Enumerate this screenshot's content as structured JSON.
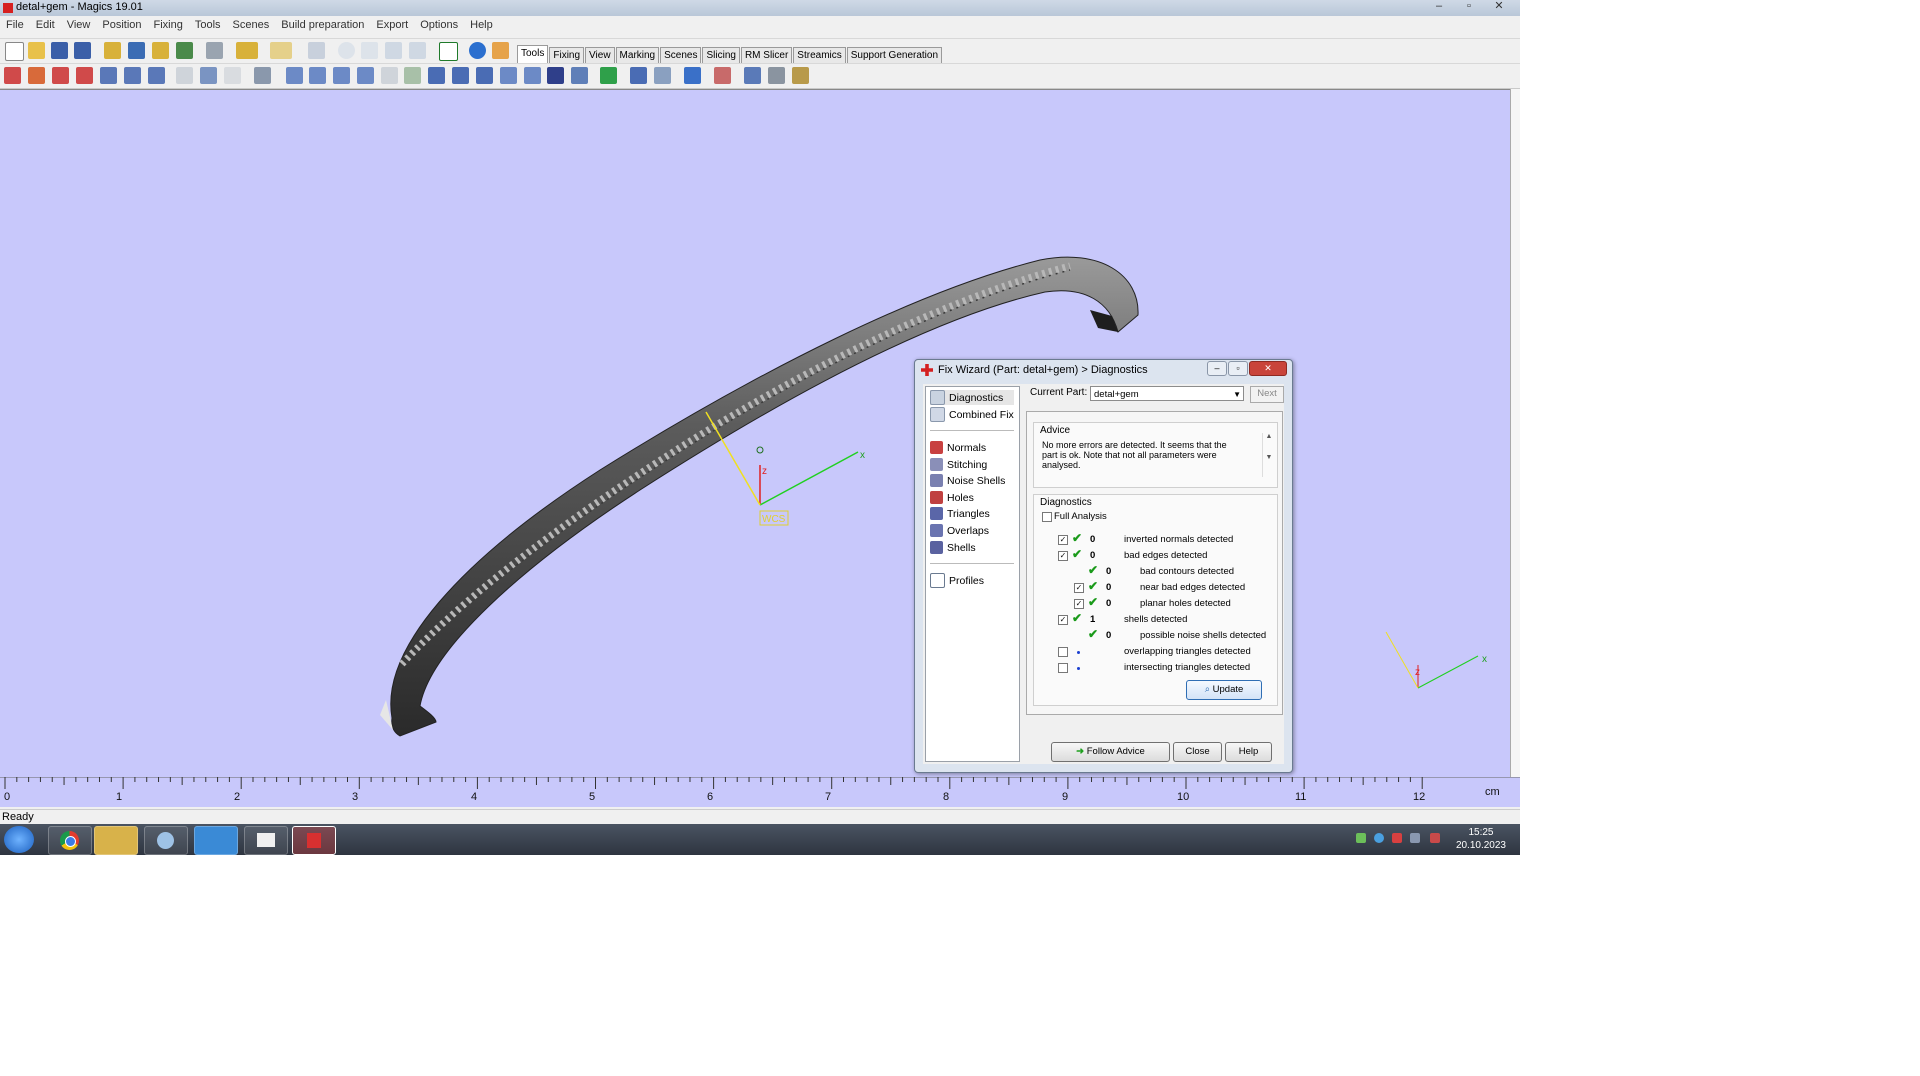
{
  "window": {
    "title": "detal+gem - Magics 19.01",
    "minimize": "–",
    "maximize": "▫",
    "close": "✕"
  },
  "menu": [
    "File",
    "Edit",
    "View",
    "Position",
    "Fixing",
    "Tools",
    "Scenes",
    "Build preparation",
    "Export",
    "Options",
    "Help"
  ],
  "tabs": [
    "Tools",
    "Fixing",
    "View",
    "Marking",
    "Scenes",
    "Slicing",
    "RM Slicer",
    "Streamics",
    "Support Generation"
  ],
  "active_tab": "Tools",
  "viewport": {
    "background": "#c8c8fb",
    "axis_labels": {
      "x": "x",
      "z": "z",
      "wcs": "WCS"
    },
    "ruler_labels": [
      "0",
      "1",
      "2",
      "3",
      "4",
      "5",
      "6",
      "7",
      "8",
      "9",
      "10",
      "11",
      "12"
    ],
    "ruler_unit": "cm"
  },
  "status": "Ready",
  "dialog": {
    "title": "Fix Wizard (Part: detal+gem) > Diagnostics",
    "title_buttons": {
      "minimize": "–",
      "maximize": "▫",
      "close": "✕"
    },
    "nav_top": [
      "Diagnostics",
      "Combined Fix"
    ],
    "nav_mid": [
      "Normals",
      "Stitching",
      "Noise Shells",
      "Holes",
      "Triangles",
      "Overlaps",
      "Shells"
    ],
    "nav_bottom": [
      "Profiles"
    ],
    "current_part_label": "Current Part:",
    "current_part_value": "detal+gem",
    "next_label": "Next",
    "advice_label": "Advice",
    "advice_text": "No more errors are detected. It seems that the part is ok. Note that not all parameters were analysed.",
    "diagnostics_label": "Diagnostics",
    "full_analysis_label": "Full Analysis",
    "rows": [
      {
        "checkbox": true,
        "status": "ok",
        "count": "0",
        "label": "inverted normals detected",
        "level": 0
      },
      {
        "checkbox": true,
        "status": "ok",
        "count": "0",
        "label": "bad edges detected",
        "level": 0
      },
      {
        "checkbox": null,
        "status": "ok",
        "count": "0",
        "label": "bad contours detected",
        "level": 1
      },
      {
        "checkbox": true,
        "status": "ok",
        "count": "0",
        "label": "near bad edges detected",
        "level": 1
      },
      {
        "checkbox": true,
        "status": "ok",
        "count": "0",
        "label": "planar holes detected",
        "level": 1
      },
      {
        "checkbox": true,
        "status": "ok",
        "count": "1",
        "label": "shells detected",
        "level": 0
      },
      {
        "checkbox": null,
        "status": "ok",
        "count": "0",
        "label": "possible noise shells detected",
        "level": 1
      },
      {
        "checkbox": false,
        "status": "none",
        "count": "",
        "label": "overlapping triangles detected",
        "level": 0
      },
      {
        "checkbox": false,
        "status": "none",
        "count": "",
        "label": "intersecting triangles detected",
        "level": 0
      }
    ],
    "update_label": "Update",
    "follow_advice_label": "Follow Advice",
    "close_label": "Close",
    "help_label": "Help"
  },
  "taskbar": {
    "time": "15:25",
    "date": "20.10.2023"
  }
}
